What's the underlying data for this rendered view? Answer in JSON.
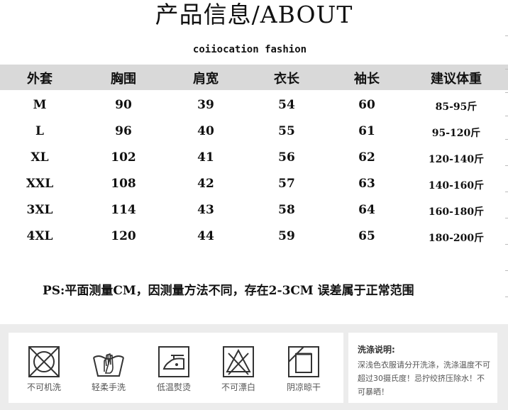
{
  "title": "产品信息/ABOUT",
  "subtitle": "coiiocation fashion",
  "headers": [
    "外套",
    "胸围",
    "肩宽",
    "衣长",
    "袖长",
    "建议体重"
  ],
  "rows": [
    [
      "M",
      "90",
      "39",
      "54",
      "60",
      "85-95斤"
    ],
    [
      "L",
      "96",
      "40",
      "55",
      "61",
      "95-120斤"
    ],
    [
      "XL",
      "102",
      "41",
      "56",
      "62",
      "120-140斤"
    ],
    [
      "XXL",
      "108",
      "42",
      "57",
      "63",
      "140-160斤"
    ],
    [
      "3XL",
      "114",
      "43",
      "58",
      "64",
      "160-180斤"
    ],
    [
      "4XL",
      "120",
      "44",
      "59",
      "65",
      "180-200斤"
    ]
  ],
  "note": "PS:平面测量CM，因测量方法不同，存在2-3CM 误差属于正常范围",
  "care": [
    {
      "label": "不可机洗",
      "icon": "no-machine-wash-icon"
    },
    {
      "label": "轻柔手洗",
      "icon": "hand-wash-icon"
    },
    {
      "label": "低温熨烫",
      "icon": "low-iron-icon"
    },
    {
      "label": "不可漂白",
      "icon": "no-bleach-icon"
    },
    {
      "label": "阴凉晾干",
      "icon": "shade-dry-icon"
    }
  ],
  "wash_title": "洗涤说明:",
  "wash_text": "深浅色衣服请分开洗涤，洗涤温度不可超过30摄氏度！忌拧绞挤压除水！不可暴晒！"
}
